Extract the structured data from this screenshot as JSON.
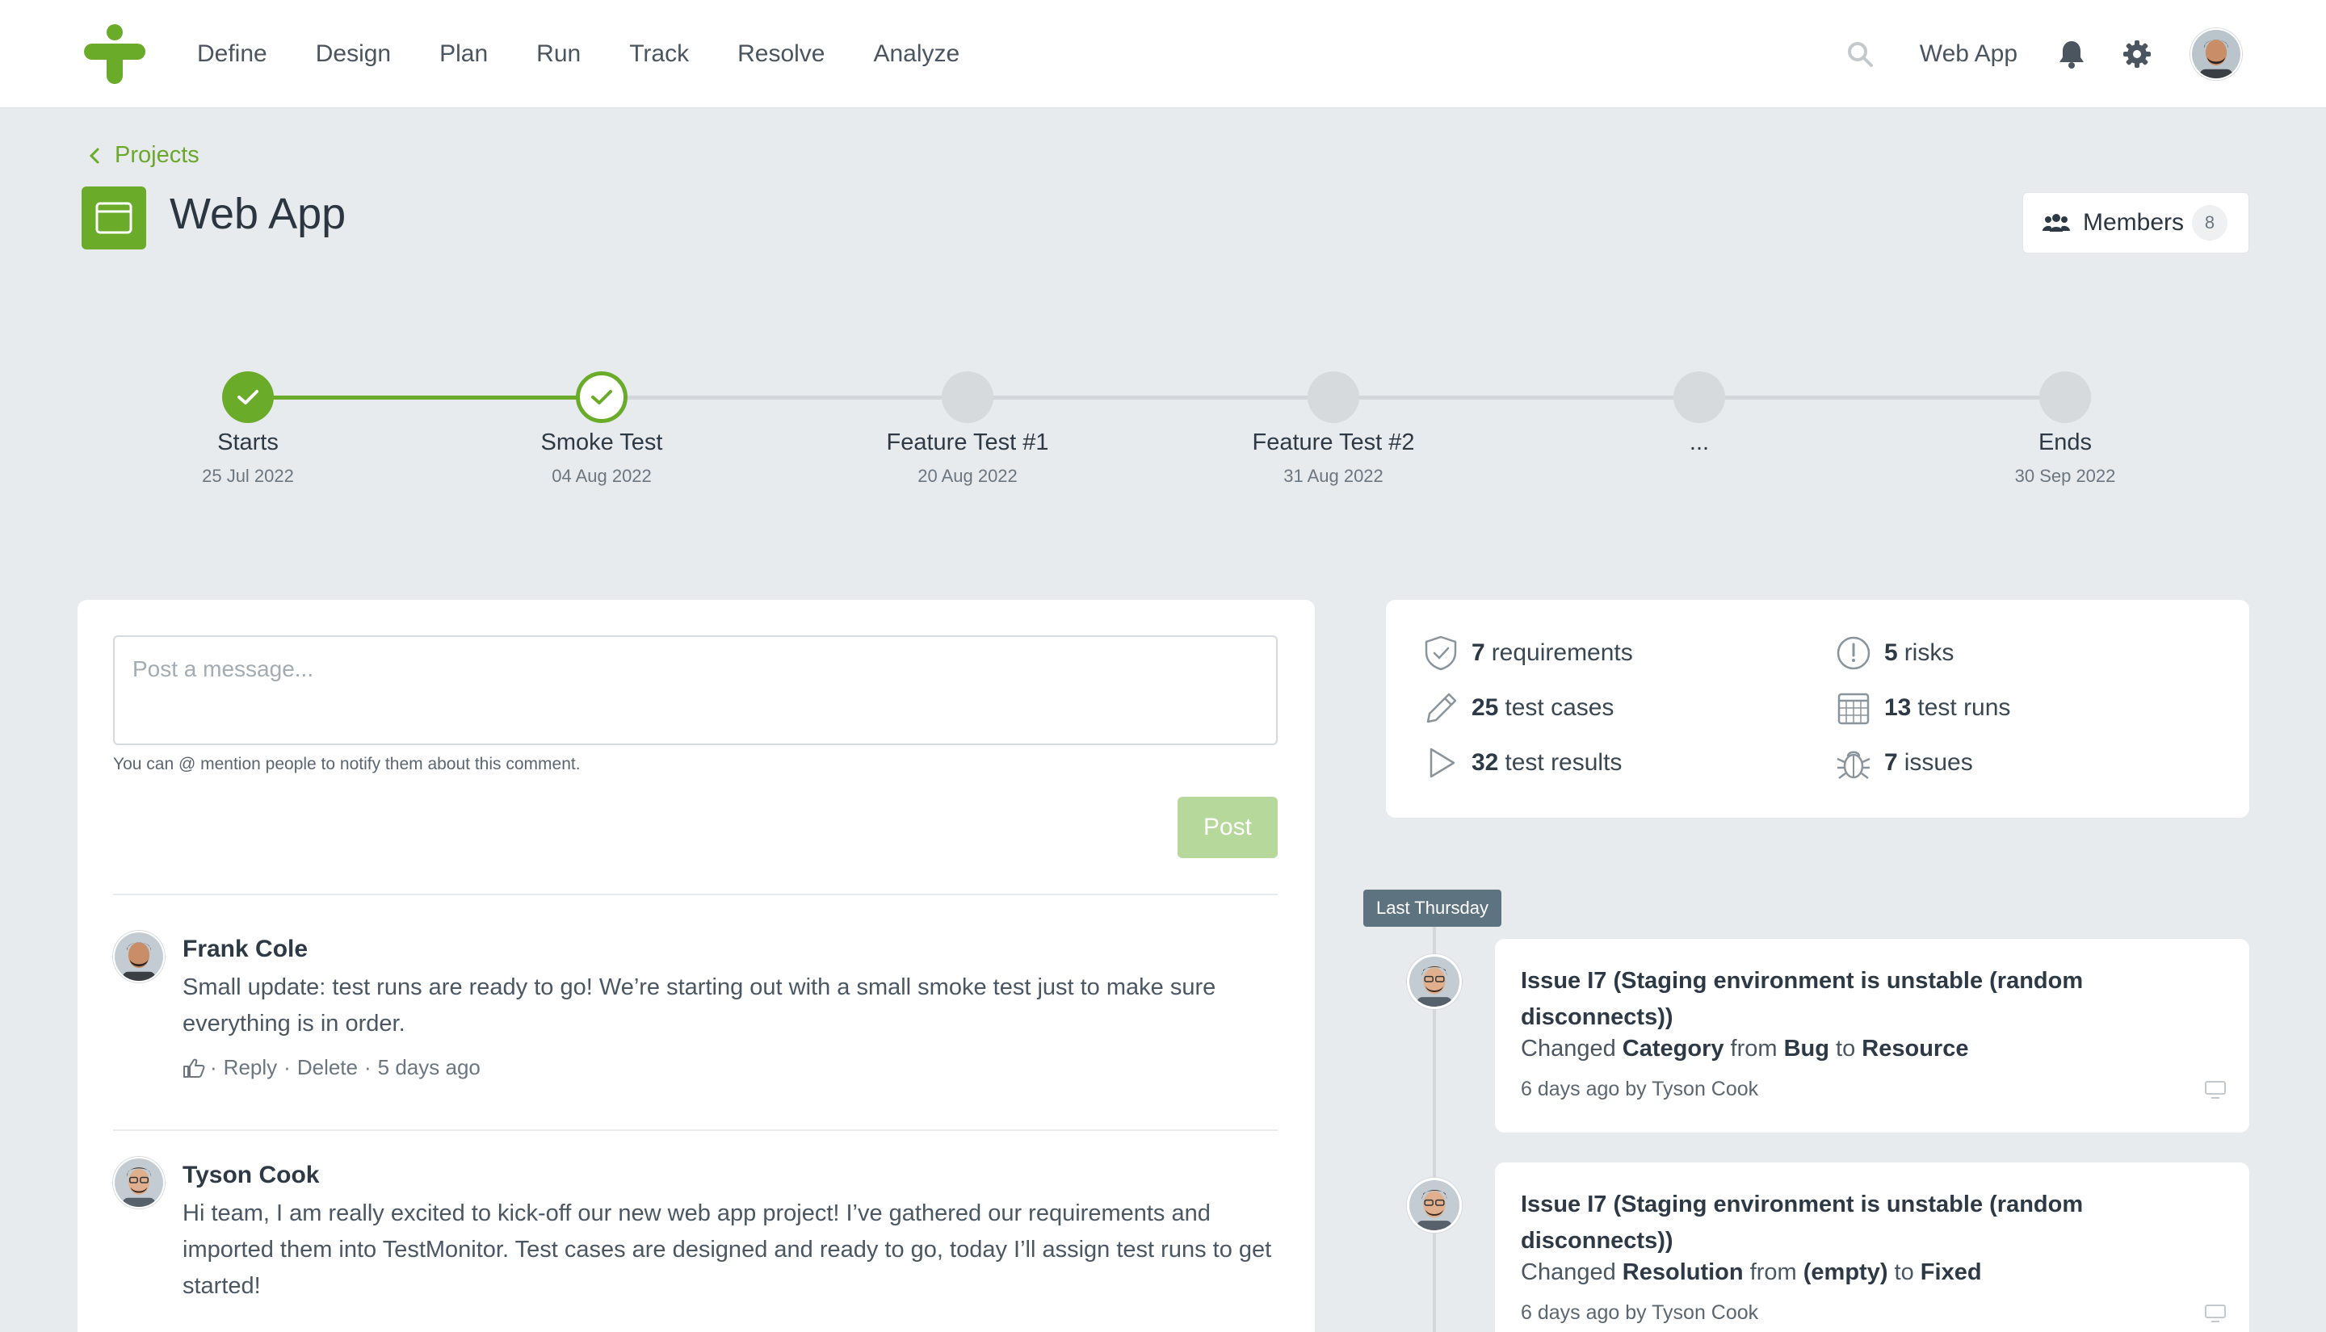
{
  "nav": {
    "items": [
      "Define",
      "Design",
      "Plan",
      "Run",
      "Track",
      "Resolve",
      "Analyze"
    ],
    "project_switcher": "Web App",
    "icons": [
      "search-icon",
      "bell-icon",
      "gear-icon"
    ]
  },
  "header": {
    "breadcrumb": "Projects",
    "title": "Web App",
    "members_label": "Members",
    "members_count": "8"
  },
  "timeline": {
    "milestones": [
      {
        "name": "Starts",
        "date": "25 Jul 2022",
        "state": "done"
      },
      {
        "name": "Smoke Test",
        "date": "04 Aug 2022",
        "state": "current"
      },
      {
        "name": "Feature Test #1",
        "date": "20 Aug 2022",
        "state": "upcoming"
      },
      {
        "name": "Feature Test #2",
        "date": "31 Aug 2022",
        "state": "upcoming"
      },
      {
        "name": "...",
        "date": "",
        "state": "upcoming"
      },
      {
        "name": "Ends",
        "date": "30 Sep 2022",
        "state": "upcoming"
      }
    ]
  },
  "composer": {
    "placeholder": "Post a message...",
    "hint": "You can @ mention people to notify them about this comment.",
    "post_label": "Post"
  },
  "comments": [
    {
      "author": "Frank Cole",
      "body": "Small update: test runs are ready to go! We’re starting out with a small smoke test just to make sure everything is in order.",
      "reply": "Reply",
      "delete": "Delete",
      "time": "5 days ago"
    },
    {
      "author": "Tyson Cook",
      "body": "Hi team, I am really excited to kick-off our new web app project! I’ve gathered our requirements and imported them into TestMonitor. Test cases are designed and ready to go, today I’ll assign test runs to get started!"
    }
  ],
  "stats": [
    {
      "count": "7",
      "label": "requirements",
      "icon": "shield-check-icon"
    },
    {
      "count": "5",
      "label": "risks",
      "icon": "exclamation-circle-icon"
    },
    {
      "count": "25",
      "label": "test cases",
      "icon": "pencil-icon"
    },
    {
      "count": "13",
      "label": "test runs",
      "icon": "calendar-icon"
    },
    {
      "count": "32",
      "label": "test results",
      "icon": "play-icon"
    },
    {
      "count": "7",
      "label": "issues",
      "icon": "bug-icon"
    }
  ],
  "activity": {
    "group_label": "Last Thursday",
    "items": [
      {
        "title": "Issue I7 (Staging environment is unstable (random disconnects))",
        "verb": "Changed",
        "field": "Category",
        "from_word": "from",
        "from": "Bug",
        "to_word": "to",
        "to": "Resource",
        "when": "6 days ago by Tyson Cook"
      },
      {
        "title": "Issue I7 (Staging environment is unstable (random disconnects))",
        "verb": "Changed",
        "field": "Resolution",
        "from_word": "from",
        "from": "(empty)",
        "to_word": "to",
        "to": "Fixed",
        "when": "6 days ago by Tyson Cook"
      }
    ]
  },
  "colors": {
    "brand_green": "#6aab2a",
    "post_disabled": "#b6d89a",
    "feed_tag": "#5e7380",
    "page_bg": "#e8ebee"
  }
}
